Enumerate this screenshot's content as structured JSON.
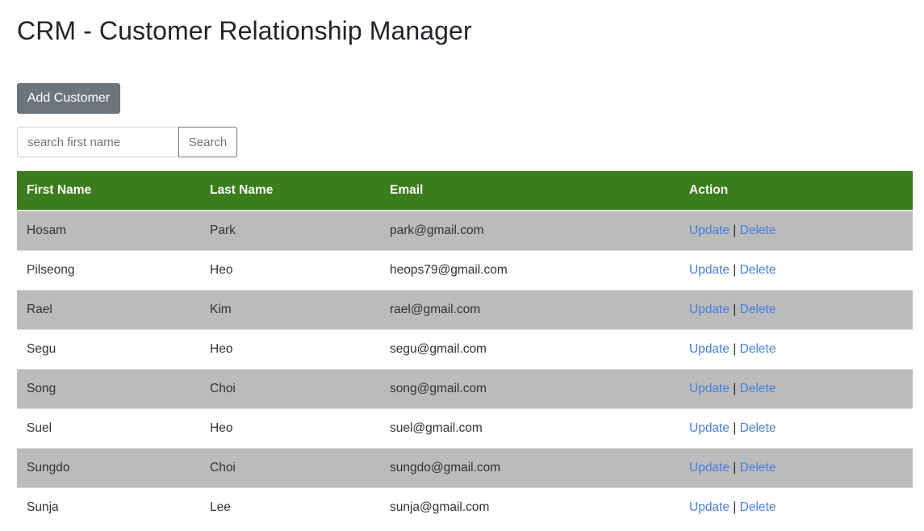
{
  "header": {
    "title": "CRM - Customer Relationship Manager"
  },
  "toolbar": {
    "add_label": "Add Customer"
  },
  "search": {
    "placeholder": "search first name",
    "button_label": "Search"
  },
  "table": {
    "header_color": "#3b7d1c",
    "columns": [
      "First Name",
      "Last Name",
      "Email",
      "Action"
    ],
    "action_labels": {
      "update": "Update",
      "separator": "|",
      "delete": "Delete"
    },
    "rows": [
      {
        "first_name": "Hosam",
        "last_name": "Park",
        "email": "park@gmail.com"
      },
      {
        "first_name": "Pilseong",
        "last_name": "Heo",
        "email": "heops79@gmail.com"
      },
      {
        "first_name": "Rael",
        "last_name": "Kim",
        "email": "rael@gmail.com"
      },
      {
        "first_name": "Segu",
        "last_name": "Heo",
        "email": "segu@gmail.com"
      },
      {
        "first_name": "Song",
        "last_name": "Choi",
        "email": "song@gmail.com"
      },
      {
        "first_name": "Suel",
        "last_name": "Heo",
        "email": "suel@gmail.com"
      },
      {
        "first_name": "Sungdo",
        "last_name": "Choi",
        "email": "sungdo@gmail.com"
      },
      {
        "first_name": "Sunja",
        "last_name": "Lee",
        "email": "sunja@gmail.com"
      }
    ]
  }
}
